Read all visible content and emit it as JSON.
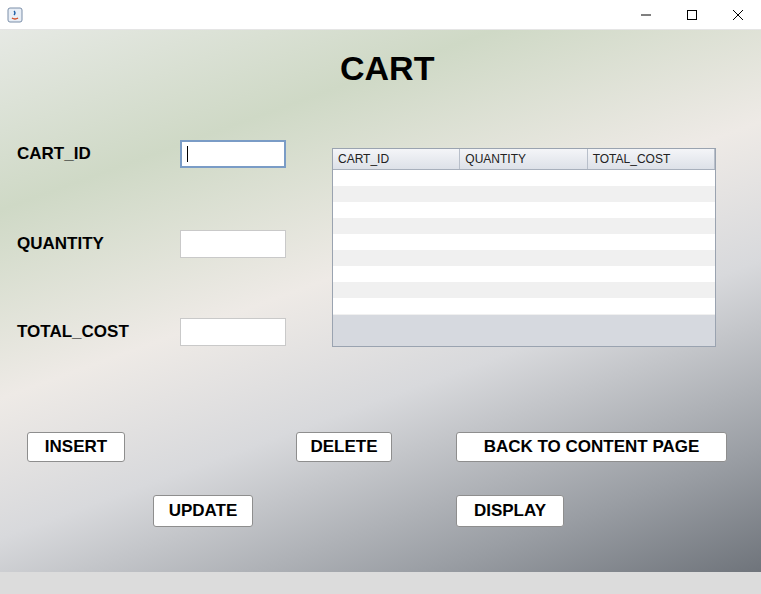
{
  "heading": "CART",
  "fields": [
    {
      "label": "CART_ID",
      "value": "",
      "focused": true
    },
    {
      "label": "QUANTITY",
      "value": "",
      "focused": false
    },
    {
      "label": "TOTAL_COST",
      "value": "",
      "focused": false
    }
  ],
  "table": {
    "columns": [
      "CART_ID",
      "QUANTITY",
      "TOTAL_COST"
    ],
    "rows": []
  },
  "button_rows": [
    [
      "INSERT",
      "DELETE",
      "BACK TO CONTENT PAGE"
    ],
    [
      "UPDATE",
      "DISPLAY"
    ]
  ]
}
